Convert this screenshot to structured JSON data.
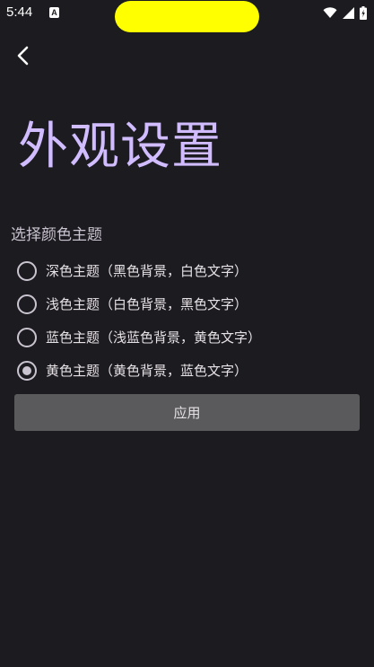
{
  "status_bar": {
    "time": "5:44",
    "notification_icon_letter": "A",
    "icons": [
      "wifi-icon",
      "signal-icon",
      "battery-icon"
    ]
  },
  "header": {
    "back_icon": "back-arrow-icon",
    "title": "外观设置"
  },
  "theme_section": {
    "label": "选择颜色主题",
    "options": [
      {
        "label": "深色主题（黑色背景，白色文字）",
        "selected": false
      },
      {
        "label": "浅色主题（白色背景，黑色文字）",
        "selected": false
      },
      {
        "label": "蓝色主题（浅蓝色背景，黄色文字）",
        "selected": false
      },
      {
        "label": "黄色主题（黄色背景，蓝色文字）",
        "selected": true
      }
    ]
  },
  "actions": {
    "apply_label": "应用"
  },
  "colors": {
    "background": "#1c1b20",
    "title": "#d0bcff",
    "button": "#5a5a5d",
    "cutout": "#ffff00"
  }
}
